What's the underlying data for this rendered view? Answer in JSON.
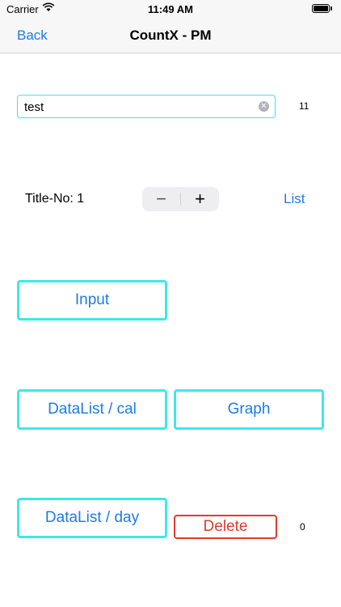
{
  "status_bar": {
    "carrier": "Carrier",
    "time": "11:49 AM",
    "icons": [
      "wifi-icon",
      "battery-icon"
    ]
  },
  "nav_bar": {
    "back_label": "Back",
    "title": "CountX - PM"
  },
  "text_field": {
    "value": "test",
    "clear_icon": "clear-icon"
  },
  "count_value": "11",
  "title_no": "Title-No: 1",
  "stepper": {
    "minus": "−",
    "plus": "+"
  },
  "list_label": "List",
  "buttons": {
    "input": "Input",
    "datalist_cal": "DataList / cal",
    "graph": "Graph",
    "datalist_day": "DataList / day",
    "delete": "Delete"
  },
  "delete_count": "0",
  "colors": {
    "accent": "#1e7be6",
    "button_border": "#3de8ec",
    "delete": "#e23a2e"
  }
}
